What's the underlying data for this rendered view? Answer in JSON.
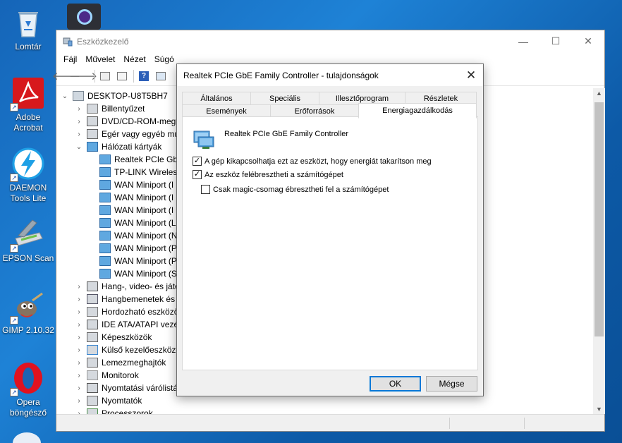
{
  "desktop": {
    "icons": [
      {
        "label": "Lomtár",
        "icon": "recycle-bin-icon"
      },
      {
        "label": "Adobe Acrobat",
        "icon": "acrobat-icon"
      },
      {
        "label": "DAEMON Tools Lite",
        "icon": "daemon-tools-icon"
      },
      {
        "label": "EPSON Scan",
        "icon": "scanner-icon"
      },
      {
        "label": "GIMP 2.10.32",
        "icon": "gimp-icon"
      },
      {
        "label": "Opera böngésző",
        "icon": "opera-icon"
      }
    ]
  },
  "devmgr": {
    "title": "Eszközkezelő",
    "menu": [
      "Fájl",
      "Művelet",
      "Nézet",
      "Súgó"
    ],
    "tree": {
      "root": "DESKTOP-U8T5BH7",
      "items": [
        {
          "label": "Billentyűzet",
          "expanded": false
        },
        {
          "label": "DVD/CD-ROM-megh",
          "expanded": false
        },
        {
          "label": "Egér vagy egyéb mu",
          "expanded": false
        },
        {
          "label": "Hálózati kártyák",
          "expanded": true
        },
        {
          "label": "Realtek PCIe GbE",
          "child": true,
          "selected": true
        },
        {
          "label": "TP-LINK Wireless",
          "child": true
        },
        {
          "label": "WAN Miniport (I",
          "child": true
        },
        {
          "label": "WAN Miniport (I",
          "child": true
        },
        {
          "label": "WAN Miniport (I",
          "child": true
        },
        {
          "label": "WAN Miniport (L",
          "child": true
        },
        {
          "label": "WAN Miniport (N",
          "child": true
        },
        {
          "label": "WAN Miniport (P",
          "child": true
        },
        {
          "label": "WAN Miniport (P",
          "child": true
        },
        {
          "label": "WAN Miniport (S",
          "child": true
        },
        {
          "label": "Hang-, video- és játé",
          "expanded": false
        },
        {
          "label": "Hangbemenetek és",
          "expanded": false
        },
        {
          "label": "Hordozható eszközö",
          "expanded": false
        },
        {
          "label": "IDE ATA/ATAPI vezérl",
          "expanded": false
        },
        {
          "label": "Képeszközök",
          "expanded": false
        },
        {
          "label": "Külső kezelőeszközö",
          "expanded": false
        },
        {
          "label": "Lemezmeghajtók",
          "expanded": false
        },
        {
          "label": "Monitorok",
          "expanded": false
        },
        {
          "label": "Nyomtatási várólistá",
          "expanded": false
        },
        {
          "label": "Nyomtatók",
          "expanded": false
        },
        {
          "label": "Processzorok",
          "expanded": false
        }
      ]
    }
  },
  "dialog": {
    "title": "Realtek PCIe GbE Family Controller - tulajdonságok",
    "tabs_row1": [
      "Általános",
      "Speciális",
      "Illesztőprogram",
      "Részletek"
    ],
    "tabs_row2": [
      "Események",
      "Erőforrások",
      "Energiagazdálkodás"
    ],
    "active_tab": "Energiagazdálkodás",
    "device_name": "Realtek PCIe GbE Family Controller",
    "options": [
      {
        "label": "A gép kikapcsolhatja ezt az eszközt, hogy energiát takarítson meg",
        "checked": true
      },
      {
        "label": "Az eszköz felébresztheti a számítógépet",
        "checked": true
      },
      {
        "label": "Csak magic-csomag ébresztheti fel a számítógépet",
        "checked": false
      }
    ],
    "ok_label": "OK",
    "cancel_label": "Mégse"
  }
}
